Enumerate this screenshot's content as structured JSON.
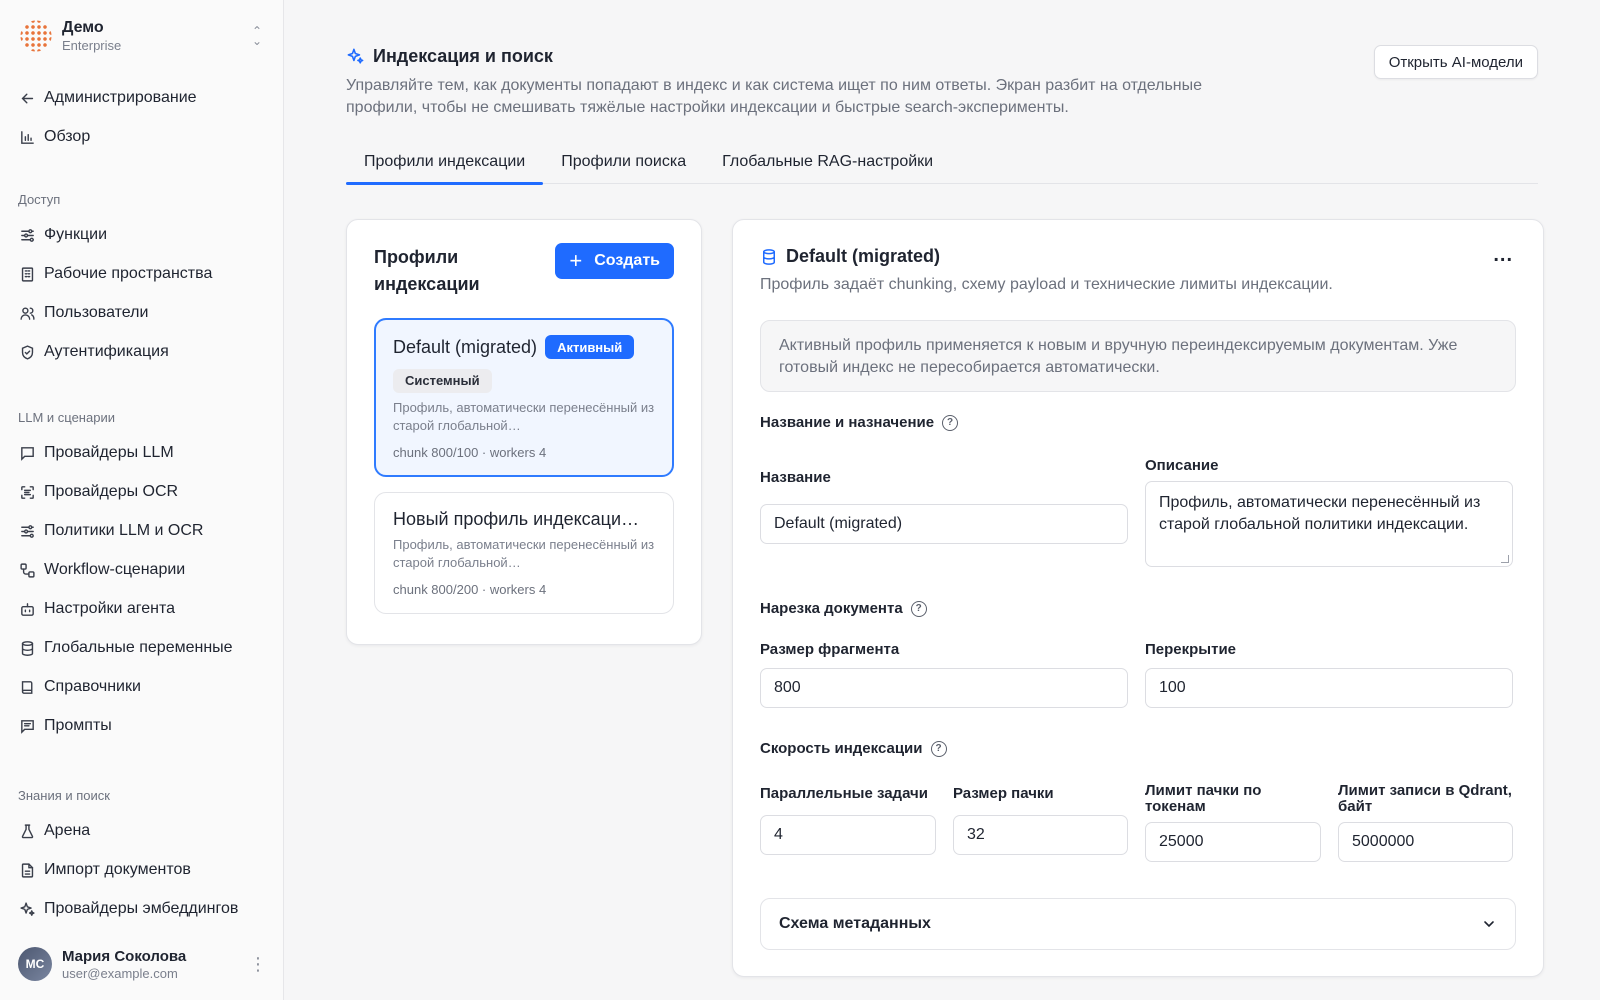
{
  "org": {
    "name": "Демо",
    "plan": "Enterprise"
  },
  "nav": {
    "back": "Администрирование",
    "overview": "Обзор",
    "groups": {
      "access": "Доступ",
      "llm": "LLM и сценарии",
      "knowledge": "Знания и поиск"
    },
    "access_items": [
      "Функции",
      "Рабочие пространства",
      "Пользователи",
      "Аутентификация"
    ],
    "llm_items": [
      "Провайдеры LLM",
      "Провайдеры OCR",
      "Политики LLM и OCR",
      "Workflow-сценарии",
      "Настройки агента",
      "Глобальные переменные",
      "Справочники",
      "Промпты"
    ],
    "knowledge_items": [
      "Арена",
      "Импорт документов",
      "Провайдеры эмбеддингов"
    ]
  },
  "user": {
    "initials": "МС",
    "name": "Мария Соколова",
    "email": "user@example.com"
  },
  "page": {
    "title": "Индексация и поиск",
    "description": "Управляйте тем, как документы попадают в индекс и как система ищет по ним ответы. Экран разбит на отдельные профили, чтобы не смешивать тяжёлые настройки индексации и быстрые search-эксперименты.",
    "open_models_button": "Открыть AI-модели"
  },
  "tabs": [
    "Профили индексации",
    "Профили поиска",
    "Глобальные RAG-настройки"
  ],
  "profiles_panel": {
    "title": "Профили индексации",
    "create_button": "Создать",
    "profiles": [
      {
        "name": "Default (migrated)",
        "active_badge": "Активный",
        "system_badge": "Системный",
        "description": "Профиль, автоматически перенесённый из старой глобальной…",
        "meta": "chunk 800/100 · workers 4"
      },
      {
        "name": "Новый профиль индексаци…",
        "description": "Профиль, автоматически перенесённый из старой глобальной…",
        "meta": "chunk 800/200 · workers 4"
      }
    ]
  },
  "detail": {
    "title": "Default (migrated)",
    "more": "...",
    "subtitle": "Профиль задаёт chunking, схему payload и технические лимиты индексации.",
    "notice": "Активный профиль применяется к новым и вручную переиндексируемым документам. Уже готовый индекс не пересобирается автоматически.",
    "section_name": {
      "title": "Название и назначение",
      "name_label": "Название",
      "name_value": "Default (migrated)",
      "desc_label": "Описание",
      "desc_value": "Профиль, автоматически перенесённый из старой глобальной политики индексации."
    },
    "section_chunking": {
      "title": "Нарезка документа",
      "size_label": "Размер фрагмента",
      "size_value": "800",
      "overlap_label": "Перекрытие",
      "overlap_value": "100"
    },
    "section_speed": {
      "title": "Скорость индексации",
      "parallel_label": "Параллельные задачи",
      "parallel_value": "4",
      "batch_label": "Размер пачки",
      "batch_value": "32",
      "token_limit_label": "Лимит пачки по токенам",
      "token_limit_value": "25000",
      "qdrant_limit_label": "Лимит записи в Qdrant, байт",
      "qdrant_limit_value": "5000000"
    },
    "metadata_schema": "Схема метаданных"
  },
  "help_mark": "?",
  "colors": {
    "accent": "#1f6bff",
    "selected_bg": "#f1f6ff"
  }
}
